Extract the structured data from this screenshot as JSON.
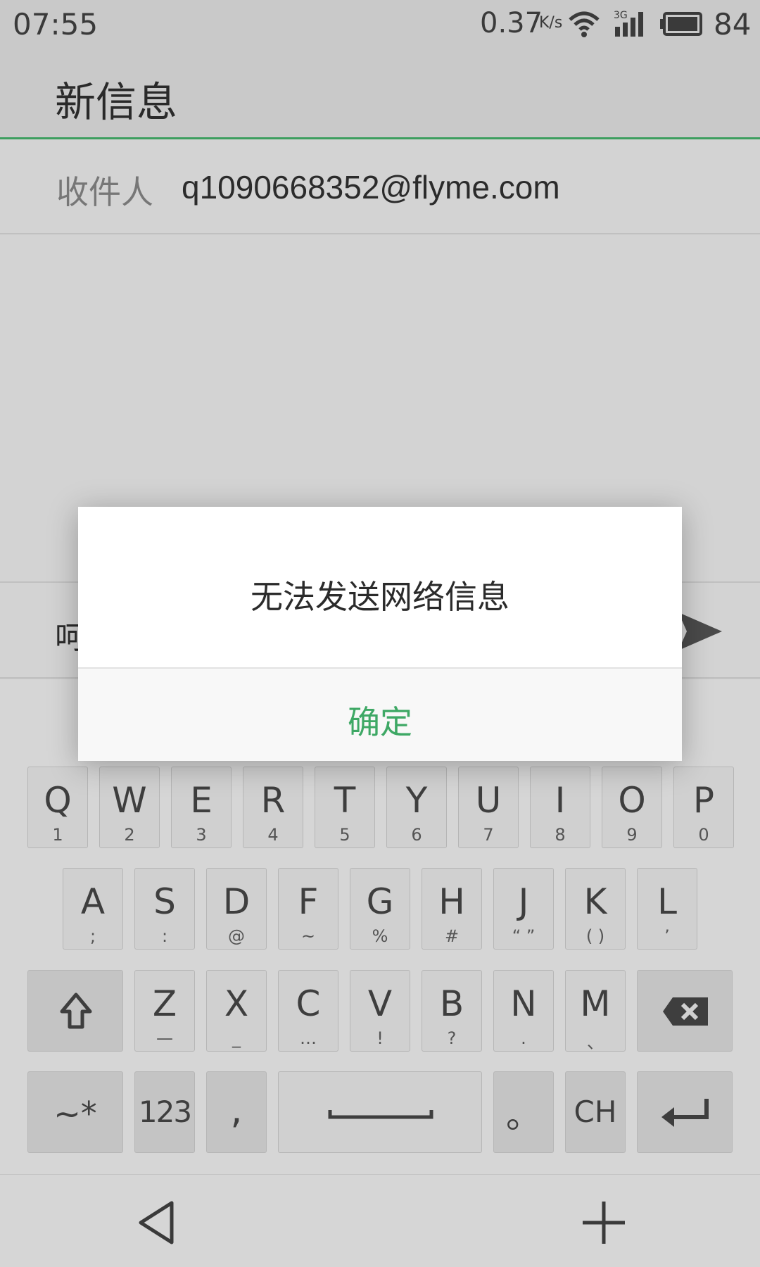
{
  "status_bar": {
    "time": "07:55",
    "speed_value": "0.37",
    "speed_unit": "K/s",
    "network_label": "3G",
    "battery": "84",
    "icons": [
      "wifi-icon",
      "signal-icon",
      "battery-icon"
    ]
  },
  "header": {
    "title": "新信息"
  },
  "recipient": {
    "label": "收件人",
    "value": "q1090668352@flyme.com"
  },
  "composer": {
    "text": "呵",
    "send_icon": "send-icon"
  },
  "dialog": {
    "message": "无法发送网络信息",
    "confirm_label": "确定",
    "accent": "#3ea865"
  },
  "keyboard": {
    "row1": [
      {
        "main": "Q",
        "sub": "1"
      },
      {
        "main": "W",
        "sub": "2"
      },
      {
        "main": "E",
        "sub": "3"
      },
      {
        "main": "R",
        "sub": "4"
      },
      {
        "main": "T",
        "sub": "5"
      },
      {
        "main": "Y",
        "sub": "6"
      },
      {
        "main": "U",
        "sub": "7"
      },
      {
        "main": "I",
        "sub": "8"
      },
      {
        "main": "O",
        "sub": "9"
      },
      {
        "main": "P",
        "sub": "0"
      }
    ],
    "row2": [
      {
        "main": "A",
        "sub": ";"
      },
      {
        "main": "S",
        "sub": ":"
      },
      {
        "main": "D",
        "sub": "@"
      },
      {
        "main": "F",
        "sub": "~"
      },
      {
        "main": "G",
        "sub": "%"
      },
      {
        "main": "H",
        "sub": "#"
      },
      {
        "main": "J",
        "sub": "“ ”"
      },
      {
        "main": "K",
        "sub": "( )"
      },
      {
        "main": "L",
        "sub": "’"
      }
    ],
    "row3": [
      {
        "main": "Z",
        "sub": "—"
      },
      {
        "main": "X",
        "sub": "_"
      },
      {
        "main": "C",
        "sub": "…"
      },
      {
        "main": "V",
        "sub": "!"
      },
      {
        "main": "B",
        "sub": "?"
      },
      {
        "main": "N",
        "sub": "."
      },
      {
        "main": "M",
        "sub": "、"
      }
    ],
    "row4": {
      "symbols": "~*",
      "numbers": "123",
      "comma": ",",
      "period": "。",
      "lang": "CH"
    },
    "icons": [
      "shift-icon",
      "backspace-icon",
      "enter-icon",
      "space-bar-icon"
    ]
  },
  "nav_bar": {
    "icons": [
      "back-icon",
      "plus-icon"
    ]
  }
}
